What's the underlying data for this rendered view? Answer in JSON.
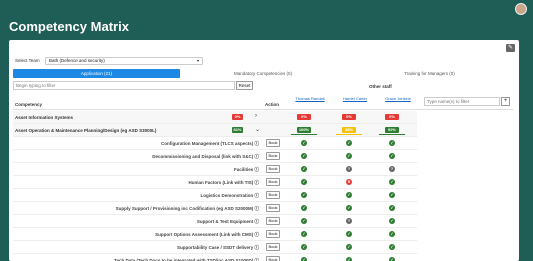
{
  "title": "Competency Matrix",
  "team": {
    "label": "Select Team",
    "value": "Bath (Defence and security)"
  },
  "tabs": [
    "Application (21)",
    "Mandatory Competencies (0)",
    "Training for Managers (0)"
  ],
  "filter": {
    "placeholder": "Begin typing to filter",
    "reset_label": "Reset"
  },
  "other_staff": "Other staff",
  "columns": {
    "competency": "Competency",
    "action": "Action"
  },
  "people": [
    {
      "name": "Thomas Randall",
      "pct": "21%"
    },
    {
      "name": "Harriet Carter",
      "pct": "38%"
    },
    {
      "name": "Grace Jenkins",
      "pct": "20%"
    }
  ],
  "name_filter": {
    "placeholder": "Type name(s) to filter",
    "add_label": "+"
  },
  "groups": [
    {
      "label": "Asset Information Systems",
      "badge": "0%",
      "badge_color": "red",
      "people": [
        "0%",
        "0%",
        "0%"
      ],
      "people_colors": [
        "red",
        "red",
        "red"
      ]
    },
    {
      "label": "Asset Operation & Maintenance Planning/Design (eg ASD S3000L)",
      "badge": "81%",
      "badge_color": "green",
      "people": [
        "100%",
        "38%",
        "92%"
      ],
      "people_colors": [
        "green",
        "yellow",
        "green"
      ]
    }
  ],
  "items": [
    {
      "label": "Configuration Management (TLCS aspects) ⓘ",
      "book": "Book",
      "status": [
        "tick",
        "tick",
        "tick"
      ]
    },
    {
      "label": "Decommissioning and Disposal (link with S&C) ⓘ",
      "book": "Book",
      "status": [
        "tick",
        "tick",
        "tick"
      ]
    },
    {
      "label": "Facilities ⓘ",
      "book": "Book",
      "status": [
        "tick",
        "unknown",
        "unknown"
      ]
    },
    {
      "label": "Human Factors (Link with TIS) ⓘ",
      "book": "Book",
      "status": [
        "tick",
        "cross",
        "tick"
      ]
    },
    {
      "label": "Logistics Demonstration ⓘ",
      "book": "Book",
      "status": [
        "tick",
        "tick",
        "tick"
      ]
    },
    {
      "label": "Supply Support / Provisioning inc Codification (eg ASD S2000M) ⓘ",
      "book": "Book",
      "status": [
        "tick",
        "tick",
        "tick"
      ]
    },
    {
      "label": "Support & Test Equipment ⓘ",
      "book": "Book",
      "status": [
        "tick",
        "unknown",
        "tick"
      ]
    },
    {
      "label": "Support Options Assessment (Link with CMS) ⓘ",
      "book": "Book",
      "status": [
        "tick",
        "tick",
        "tick"
      ]
    },
    {
      "label": "Supportability Case / SSDT delivery ⓘ",
      "book": "Book",
      "status": [
        "tick",
        "tick",
        "tick"
      ]
    },
    {
      "label": "Tech Data (Tech Docs to be integrated with TSD/inc ASD S1000D) ⓘ",
      "book": "Book",
      "status": [
        "tick",
        "tick",
        "tick"
      ]
    }
  ],
  "colors": {
    "header_bg": "#1f5d57",
    "accent": "#1e88e5",
    "green": "#2e7d32",
    "red": "#e53935",
    "yellow": "#f4c20d"
  },
  "icons": {
    "tick": "check-icon",
    "cross": "cross-icon",
    "unknown": "question-icon",
    "expand": "chevron-icon"
  }
}
